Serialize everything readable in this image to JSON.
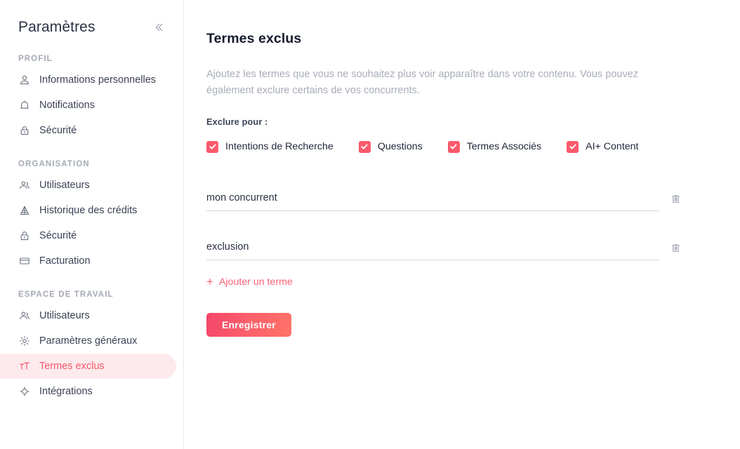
{
  "sidebar": {
    "title": "Paramètres",
    "collapse_icon": "double-chevron-left-icon",
    "sections": [
      {
        "heading": "PROFIL",
        "items": [
          {
            "label": "Informations personnelles",
            "icon": "user-icon",
            "active": false
          },
          {
            "label": "Notifications",
            "icon": "bell-icon",
            "active": false
          },
          {
            "label": "Sécurité",
            "icon": "lock-icon",
            "active": false
          }
        ]
      },
      {
        "heading": "ORGANISATION",
        "items": [
          {
            "label": "Utilisateurs",
            "icon": "users-icon",
            "active": false
          },
          {
            "label": "Historique des crédits",
            "icon": "pyramid-icon",
            "active": false
          },
          {
            "label": "Sécurité",
            "icon": "lock-icon",
            "active": false
          },
          {
            "label": "Facturation",
            "icon": "credit-card-icon",
            "active": false
          }
        ]
      },
      {
        "heading": "ESPACE DE TRAVAIL",
        "items": [
          {
            "label": "Utilisateurs",
            "icon": "users-icon",
            "active": false
          },
          {
            "label": "Paramètres généraux",
            "icon": "gear-icon",
            "active": false
          },
          {
            "label": "Termes exclus",
            "icon": "text-format-icon",
            "active": true
          },
          {
            "label": "Intégrations",
            "icon": "integrations-target-icon",
            "active": false
          }
        ]
      }
    ]
  },
  "main": {
    "title": "Termes exclus",
    "description": "Ajoutez les termes que vous ne souhaitez plus voir apparaître dans votre contenu. Vous pouvez également exclure certains de vos concurrents.",
    "exclude_for_label": "Exclure pour :",
    "checkboxes": [
      {
        "label": "Intentions de Recherche",
        "checked": true
      },
      {
        "label": "Questions",
        "checked": true
      },
      {
        "label": "Termes Associés",
        "checked": true
      },
      {
        "label": "AI+ Content",
        "checked": true
      }
    ],
    "terms": [
      {
        "value": "mon concurrent",
        "placeholder": "Terme à exclure",
        "delete_icon": "trash-icon"
      },
      {
        "value": "exclusion",
        "placeholder": "Terme à exclure",
        "delete_icon": "trash-icon"
      }
    ],
    "add_term_label": "Ajouter un terme",
    "add_term_icon": "plus-icon",
    "save_label": "Enregistrer"
  },
  "colors": {
    "accent": "#fa5a6c",
    "accent_soft": "#fdeaec",
    "text_primary": "#1f2539",
    "text_muted": "#a8adb8",
    "border": "#e6e8ec"
  }
}
